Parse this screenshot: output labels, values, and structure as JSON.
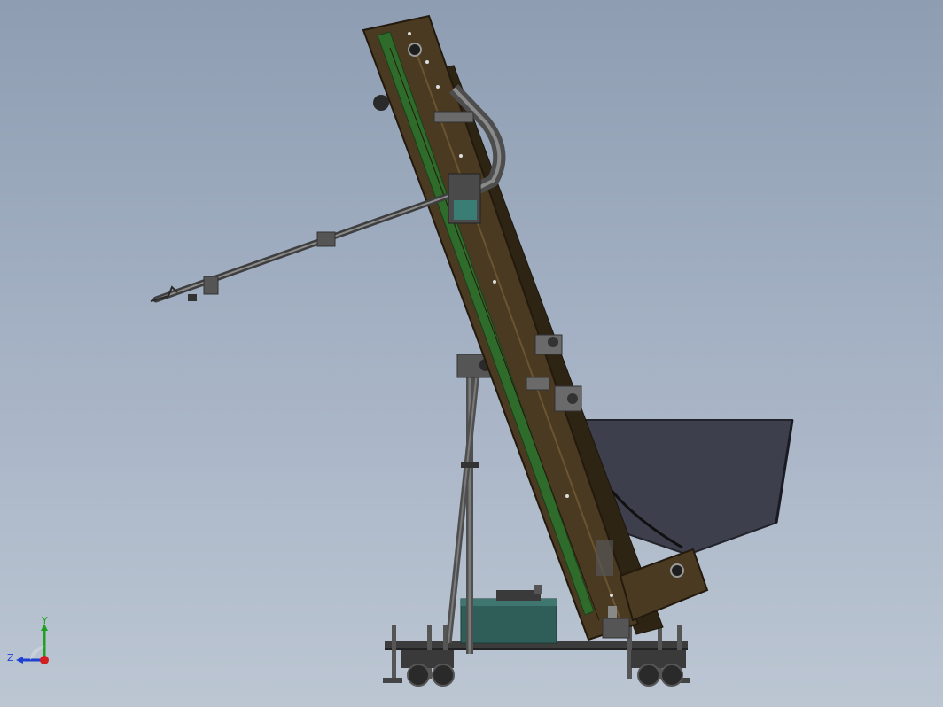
{
  "viewport": {
    "background_top": "#8e9db2",
    "background_bottom": "#bcc6d3"
  },
  "colors": {
    "frame_brown": "#4a3a22",
    "frame_brown_dark": "#2e2414",
    "belt_green": "#2f6b2a",
    "hopper_gray": "#3d3f4c",
    "steel": "#5a5a5a",
    "steel_light": "#8a8a8a",
    "teal_box": "#2f5e58",
    "triad_x": "#d02020",
    "triad_y": "#20a020",
    "triad_z": "#2040d0"
  },
  "triad": {
    "x_label": "",
    "y_label": "Y",
    "z_label": "Z"
  }
}
